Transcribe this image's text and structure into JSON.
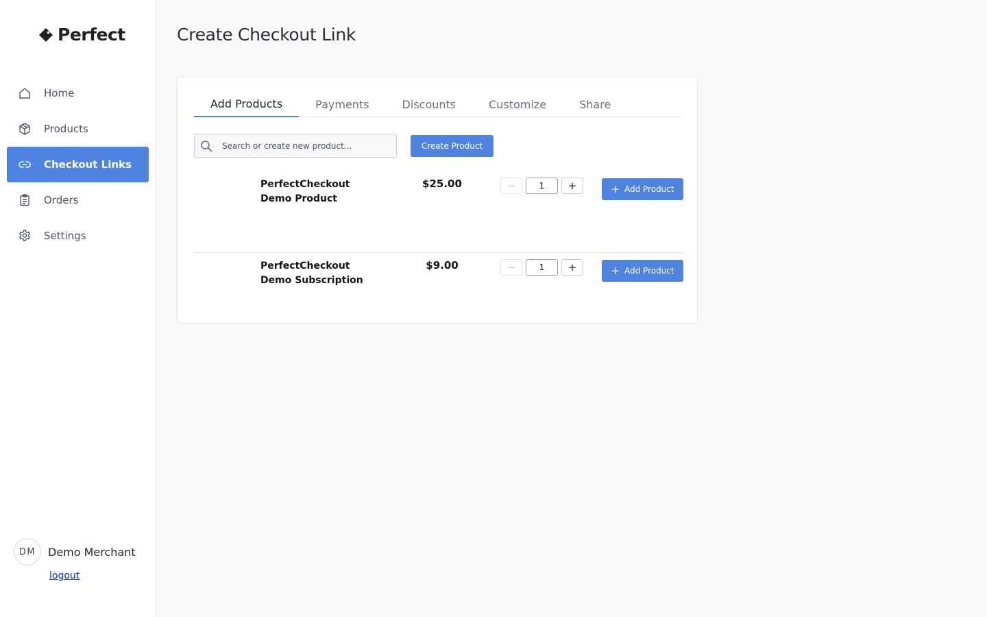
{
  "brand": {
    "name": "Perfect",
    "logo_icon": "tag-diamond-icon"
  },
  "sidebar": {
    "items": [
      {
        "label": "Home",
        "icon": "home-icon",
        "active": false
      },
      {
        "label": "Products",
        "icon": "box-icon",
        "active": false
      },
      {
        "label": "Checkout Links",
        "icon": "link-icon",
        "active": true
      },
      {
        "label": "Orders",
        "icon": "clipboard-icon",
        "active": false
      },
      {
        "label": "Settings",
        "icon": "gear-icon",
        "active": false
      }
    ]
  },
  "user": {
    "initials": "DM",
    "name": "Demo Merchant",
    "logout_label": "logout"
  },
  "page": {
    "title": "Create Checkout Link"
  },
  "tabs": [
    {
      "label": "Add Products",
      "active": true
    },
    {
      "label": "Payments",
      "active": false
    },
    {
      "label": "Discounts",
      "active": false
    },
    {
      "label": "Customize",
      "active": false
    },
    {
      "label": "Share",
      "active": false
    }
  ],
  "search": {
    "placeholder": "Search or create new product...",
    "value": ""
  },
  "create_product_label": "Create Product",
  "products": [
    {
      "name": "PerfectCheckout Demo Product",
      "price": "$25.00",
      "quantity": "1",
      "add_label": "Add Product",
      "decrement": "−",
      "increment": "+"
    },
    {
      "name": "PerfectCheckout Demo Subscription",
      "price": "$9.00",
      "quantity": "1",
      "add_label": "Add Product",
      "decrement": "−",
      "increment": "+"
    }
  ],
  "colors": {
    "accent": "#4f83e0",
    "link": "#0b2cd8",
    "background": "#f8f9fb"
  }
}
